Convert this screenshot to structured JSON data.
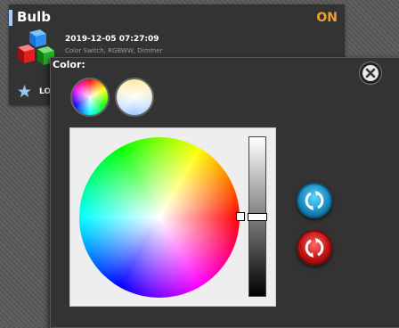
{
  "device": {
    "name": "Bulb",
    "status": "ON",
    "last_update": "2019-12-05 07:27:09",
    "type": "Color Switch, RGBWW, Dimmer",
    "log_label": "LO",
    "icon": "rgb-cubes-icon"
  },
  "color_popup": {
    "title": "Color:",
    "close_icon": "close-icon",
    "modes": [
      {
        "name": "rgb-mode",
        "icon": "rgb-color-wheel-icon",
        "active": true
      },
      {
        "name": "white-mode",
        "icon": "white-temperature-wheel-icon",
        "active": false
      }
    ],
    "picker": {
      "selected_hue_color": "#ff0000",
      "brightness_level": 0.5
    },
    "apply_icon": "apply-refresh-icon",
    "reset_icon": "reset-refresh-icon"
  },
  "colors": {
    "status_on": "#f0a030",
    "apply": "#1a8fc4",
    "reset": "#c21414"
  }
}
